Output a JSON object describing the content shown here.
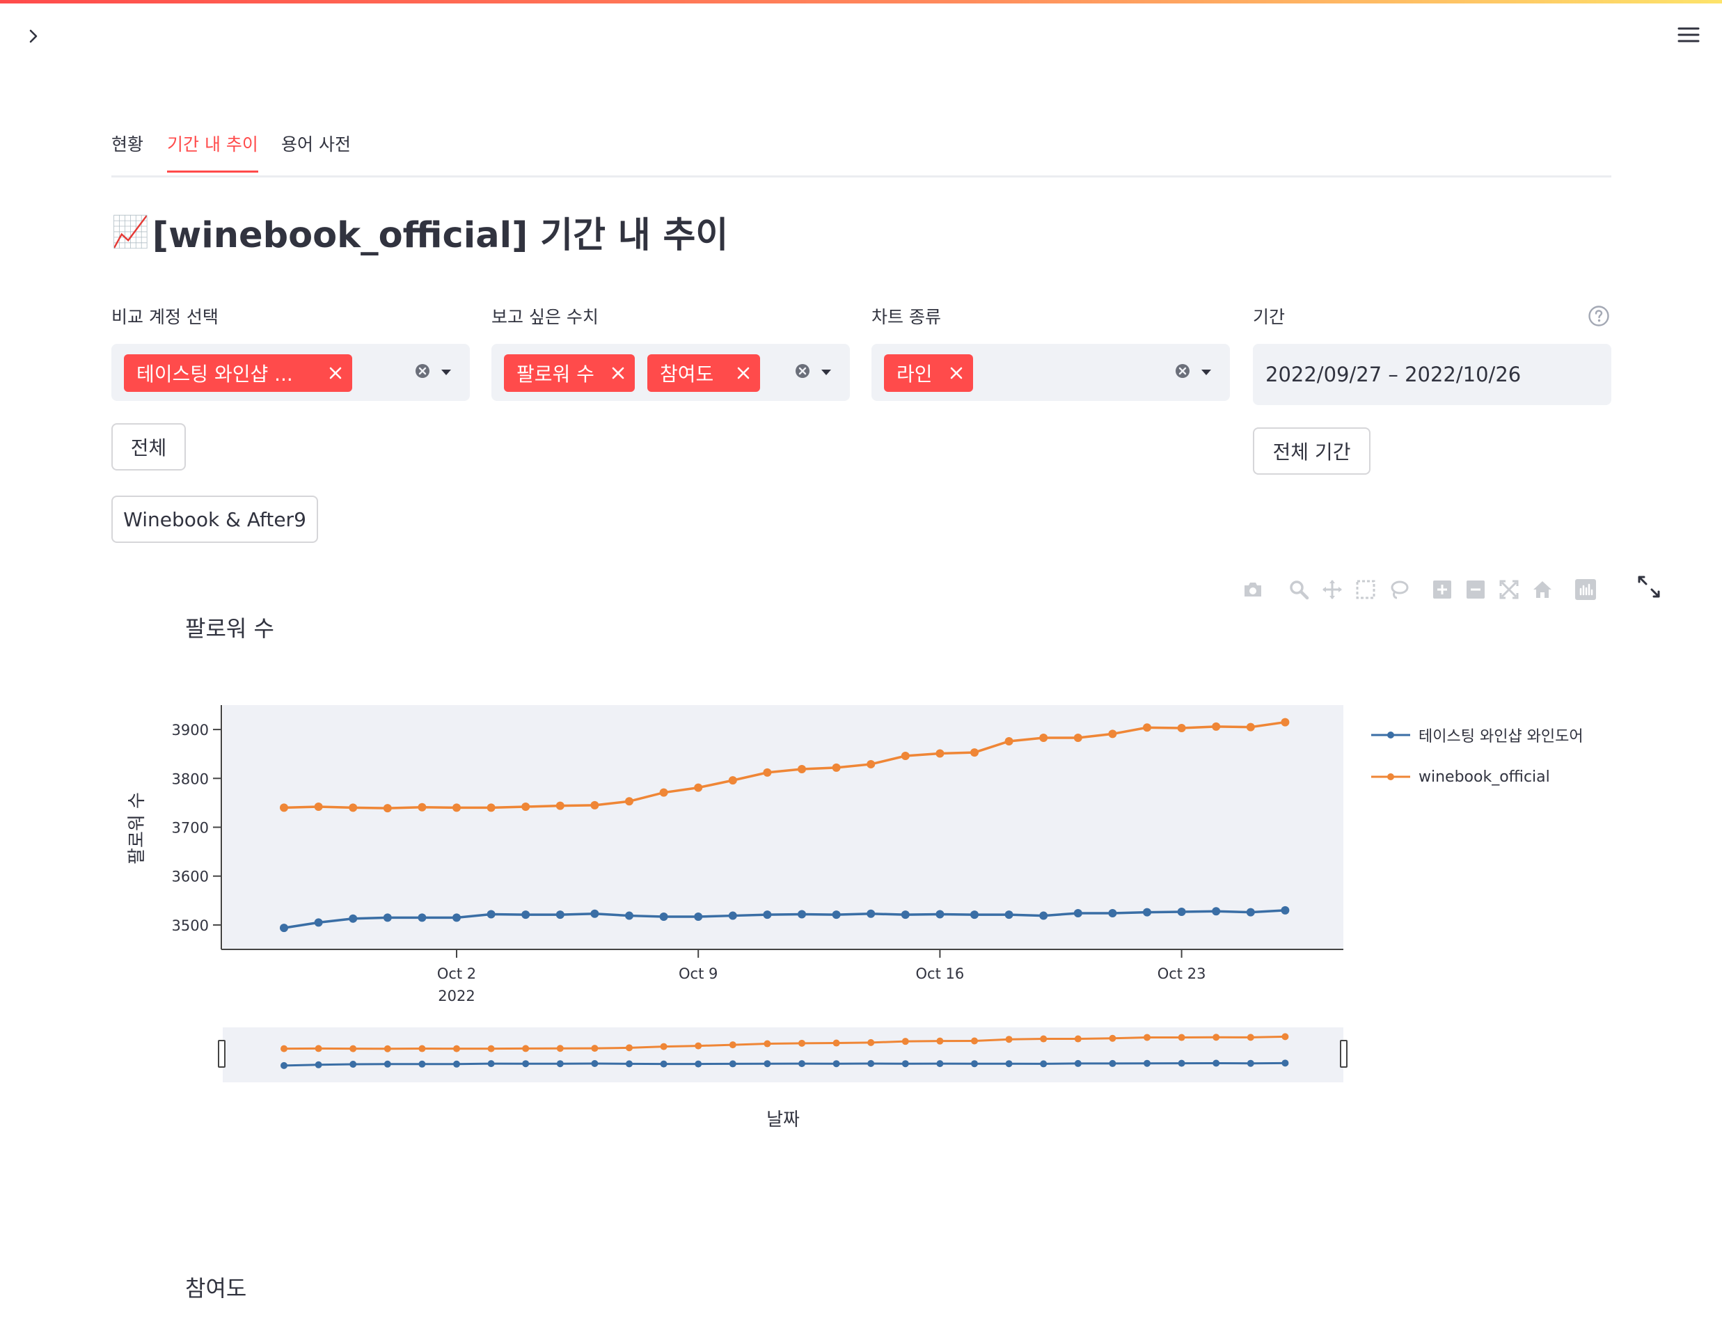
{
  "tabs": [
    {
      "label": "현황",
      "active": false
    },
    {
      "label": "기간 내 추이",
      "active": true
    },
    {
      "label": "용어 사전",
      "active": false
    }
  ],
  "page": {
    "title_emoji": "📈",
    "title": "[winebook_official] 기간 내 추이"
  },
  "controls": {
    "compare_accounts": {
      "label": "비교 계정 선택",
      "chips": [
        "테이스팅 와인샵 ..."
      ],
      "all_button": "전체",
      "preset_button": "Winebook & After9"
    },
    "metrics": {
      "label": "보고 싶은 수치",
      "chips": [
        "팔로워 수",
        "참여도"
      ]
    },
    "chart_type": {
      "label": "차트 종류",
      "chips": [
        "라인"
      ]
    },
    "period": {
      "label": "기간",
      "value": "2022/09/27 – 2022/10/26",
      "all_period_button": "전체 기간"
    }
  },
  "icons": {
    "sidebar_toggle": "chevron-right-icon",
    "main_menu": "hamburger-menu-icon",
    "help": "question-circle-icon",
    "fullscreen": "expand-icon",
    "modebar": [
      "camera-icon",
      "zoom-icon",
      "pan-icon",
      "box-select-icon",
      "lasso-icon",
      "zoom-in-icon",
      "zoom-out-icon",
      "autoscale-icon",
      "reset-axes-icon",
      "plotly-logo-icon"
    ]
  },
  "colors": {
    "accent": "#ff4b4b",
    "series_blue": "#3a6ea5",
    "series_orange": "#ef8636",
    "plot_bg": "#eff1f6"
  },
  "chart_data": {
    "type": "line",
    "title": "팔로워 수",
    "xlabel": "날짜",
    "ylabel": "팔로워 수",
    "x_ticks": [
      "Oct 2\n2022",
      "Oct 9",
      "Oct 16",
      "Oct 23"
    ],
    "y_ticks": [
      3500,
      3600,
      3700,
      3800,
      3900
    ],
    "ylim": [
      3450,
      3950
    ],
    "x": [
      "2022-09-27",
      "2022-09-28",
      "2022-09-29",
      "2022-09-30",
      "2022-10-01",
      "2022-10-02",
      "2022-10-03",
      "2022-10-04",
      "2022-10-05",
      "2022-10-06",
      "2022-10-07",
      "2022-10-08",
      "2022-10-09",
      "2022-10-10",
      "2022-10-11",
      "2022-10-12",
      "2022-10-13",
      "2022-10-14",
      "2022-10-15",
      "2022-10-16",
      "2022-10-17",
      "2022-10-18",
      "2022-10-19",
      "2022-10-20",
      "2022-10-21",
      "2022-10-22",
      "2022-10-23",
      "2022-10-24",
      "2022-10-25",
      "2022-10-26"
    ],
    "series": [
      {
        "name": "테이스팅 와인샵 와인도어",
        "color": "#3a6ea5",
        "values": [
          3494,
          3505,
          3513,
          3515,
          3515,
          3515,
          3522,
          3521,
          3521,
          3523,
          3519,
          3517,
          3517,
          3519,
          3521,
          3522,
          3521,
          3523,
          3521,
          3522,
          3521,
          3521,
          3519,
          3524,
          3524,
          3526,
          3527,
          3528,
          3526,
          3530
        ]
      },
      {
        "name": "winebook_official",
        "color": "#ef8636",
        "values": [
          3740,
          3742,
          3740,
          3739,
          3741,
          3740,
          3740,
          3742,
          3744,
          3745,
          3753,
          3771,
          3781,
          3796,
          3812,
          3819,
          3822,
          3829,
          3846,
          3851,
          3853,
          3876,
          3883,
          3883,
          3891,
          3904,
          3903,
          3906,
          3905,
          3915
        ]
      }
    ],
    "legend_position": "right",
    "second_chart_title": "참여도"
  }
}
